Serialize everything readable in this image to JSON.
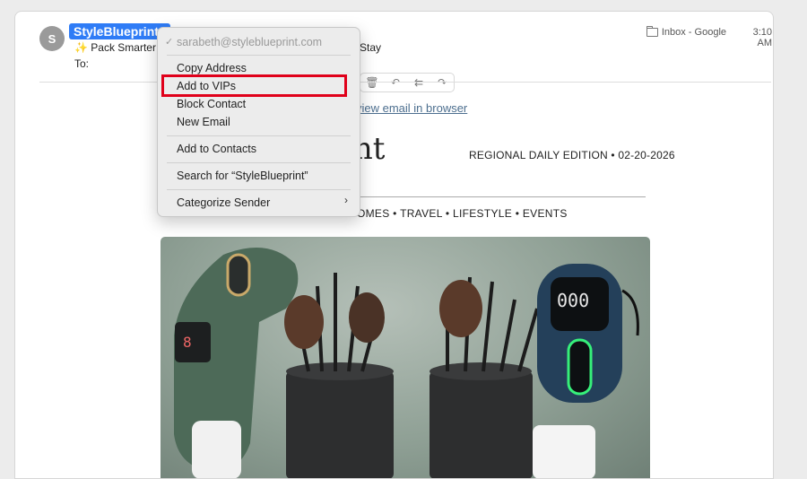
{
  "message": {
    "avatar_initial": "S",
    "sender_name": "StyleBlueprint",
    "subject_start": "✨ Pack Smarter!",
    "subject_end": "Stay",
    "to_label": "To:",
    "mailbox": "Inbox - Google",
    "time": "3:10 AM"
  },
  "email_body": {
    "view_in_browser": "view email in browser",
    "brand_partial": "int",
    "edition": "REGIONAL DAILY EDITION  •  02-20-2026",
    "nav": "OMES  •  TRAVEL  •  LIFESTYLE  •  EVENTS"
  },
  "context_menu": {
    "sender_email": "sarabeth@styleblueprint.com",
    "copy_address": "Copy Address",
    "add_to_vips": "Add to VIPs",
    "block_contact": "Block Contact",
    "new_email": "New Email",
    "add_to_contacts": "Add to Contacts",
    "search_for": "Search for “StyleBlueprint”",
    "categorize_sender": "Categorize Sender"
  },
  "colors": {
    "accent": "#2f7cf6",
    "highlight": "#e0001a",
    "link": "#4d6f8f"
  }
}
